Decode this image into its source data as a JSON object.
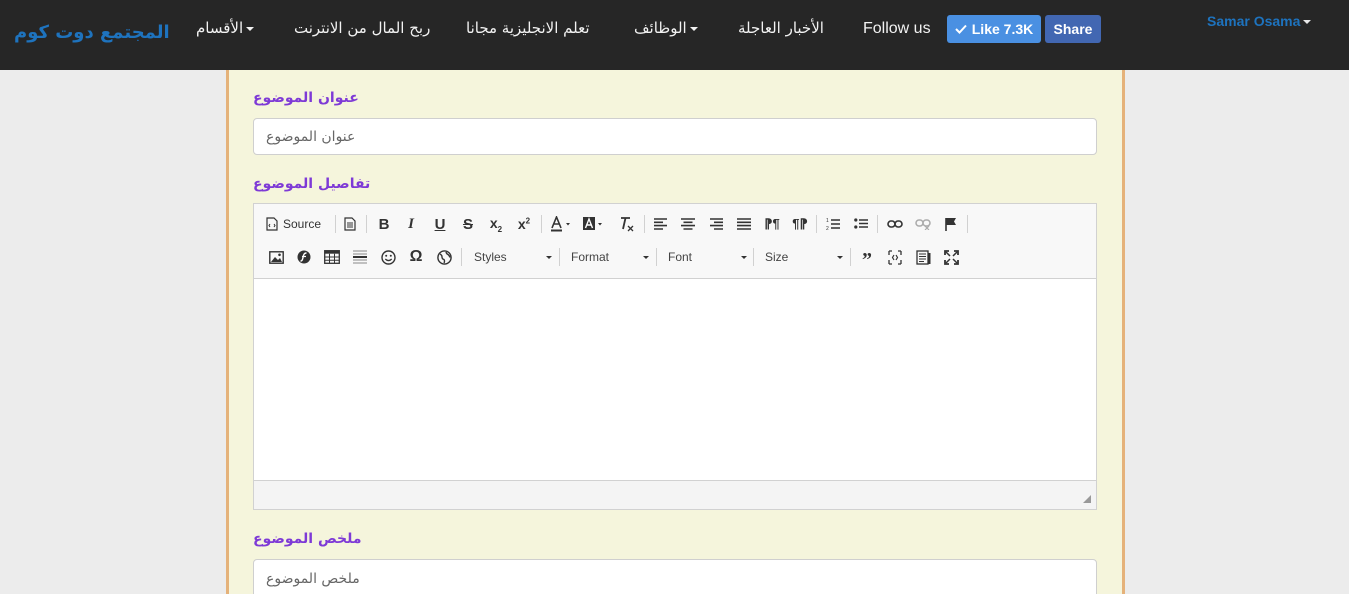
{
  "navbar": {
    "brand": "المجتمع دوت كوم",
    "items": [
      {
        "label": "الأقسام",
        "dropdown": true
      },
      {
        "label": "ربح المال من الانترنت",
        "dropdown": false
      },
      {
        "label": "تعلم الانجليزية مجانا",
        "dropdown": false
      },
      {
        "label": "الوظائف",
        "dropdown": true
      },
      {
        "label": "الأخبار العاجلة",
        "dropdown": false
      }
    ],
    "follow_label": "Follow us",
    "like_label": "Like 7.3K",
    "share_label": "Share",
    "user_name": "Samar Osama"
  },
  "form": {
    "title_label": "عنوان الموضوع",
    "title_placeholder": "عنوان الموضوع",
    "details_label": "تفاصيل الموضوع",
    "summary_label": "ملخص الموضوع",
    "summary_placeholder": "ملخص الموضوع"
  },
  "editor": {
    "source_label": "Source",
    "styles_label": "Styles",
    "format_label": "Format",
    "font_label": "Font",
    "size_label": "Size",
    "icons_row1": [
      "source-icon",
      "templates-icon",
      "bold-icon",
      "italic-icon",
      "underline-icon",
      "strikethrough-icon",
      "subscript-icon",
      "superscript-icon",
      "text-color-icon",
      "background-color-icon",
      "remove-format-icon",
      "align-left-icon",
      "align-center-icon",
      "align-right-icon",
      "justify-icon",
      "ltr-icon",
      "rtl-icon",
      "numbered-list-icon",
      "bulleted-list-icon",
      "link-icon",
      "unlink-icon",
      "anchor-icon"
    ],
    "icons_row2": [
      "image-icon",
      "flash-icon",
      "table-icon",
      "horizontal-line-icon",
      "smiley-icon",
      "special-char-icon",
      "iframe-icon",
      "blockquote-icon",
      "show-blocks-icon",
      "preview-icon",
      "maximize-icon"
    ]
  },
  "colors": {
    "navbar_bg": "#262626",
    "brand": "#1e73be",
    "label": "#7e3ad6",
    "panel_bg": "#f5f5dc",
    "panel_border": "#e5b27a",
    "like_bg": "#4a90e2",
    "share_bg": "#4267b2"
  }
}
